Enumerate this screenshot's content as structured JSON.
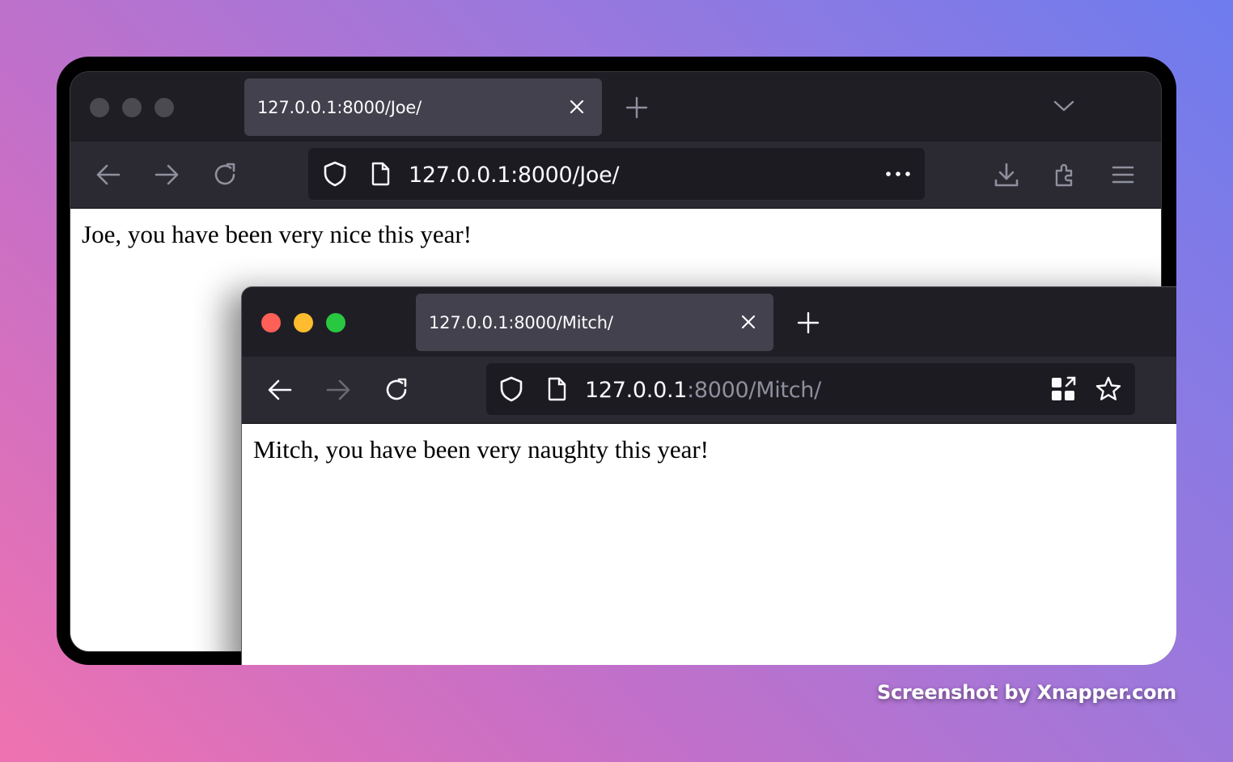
{
  "window_joe": {
    "tab_title": "127.0.0.1:8000/Joe/",
    "url": "127.0.0.1:8000/Joe/",
    "page_text": "Joe, you have been very nice this year!",
    "icons": [
      "back-icon",
      "forward-icon",
      "reload-icon",
      "shield-icon",
      "page-icon",
      "more-icon",
      "download-icon",
      "extensions-icon",
      "menu-icon",
      "tab-list-chevron-icon",
      "new-tab-plus-icon",
      "close-tab-icon"
    ]
  },
  "window_mitch": {
    "tab_title": "127.0.0.1:8000/Mitch/",
    "url_host": "127.0.0.1",
    "url_rest": ":8000/Mitch/",
    "page_text": "Mitch, you have been very naughty this year!",
    "icons": [
      "back-icon",
      "forward-icon",
      "reload-icon",
      "shield-icon",
      "page-icon",
      "qr-code-icon",
      "bookmark-star-icon",
      "new-tab-plus-icon",
      "close-tab-icon"
    ]
  },
  "credit": "Screenshot by Xnapper.com",
  "colors": {
    "tab_bg": "#42414d",
    "chrome_bg": "#1f1e25",
    "toolbar_bg": "#2b2a33",
    "urlbar_bg": "#1c1b22",
    "traffic_red": "#fe5f57",
    "traffic_yellow": "#febc2e",
    "traffic_green": "#28c840"
  }
}
